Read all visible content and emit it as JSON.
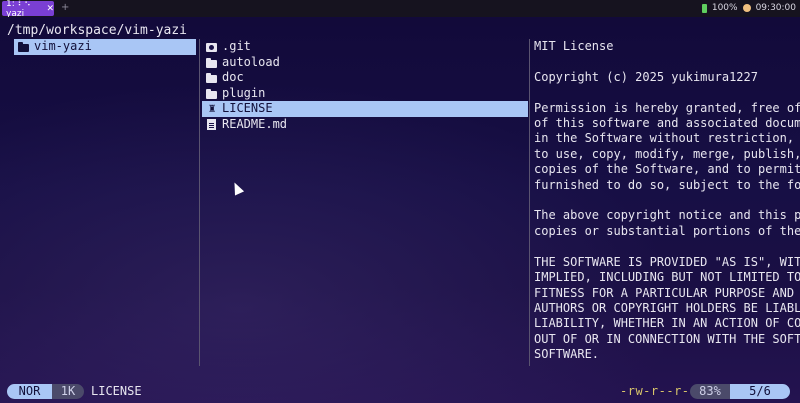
{
  "window": {
    "tab_label": "1: ⠇⠢ yazi",
    "tab_close": "✕",
    "new_tab": "+",
    "battery": "100%",
    "time": "09:30:00"
  },
  "yazi": {
    "cwd": "/tmp/workspace/vim-yazi",
    "parent_items": [
      {
        "name": "vim-yazi",
        "icon": "folder-icon",
        "selected": true
      }
    ],
    "current_items": [
      {
        "name": ".git",
        "icon": "git-folder-icon",
        "selected": false
      },
      {
        "name": "autoload",
        "icon": "folder-icon",
        "selected": false
      },
      {
        "name": "doc",
        "icon": "folder-icon",
        "selected": false
      },
      {
        "name": "plugin",
        "icon": "folder-icon",
        "selected": false
      },
      {
        "name": "LICENSE",
        "icon": "license-icon",
        "selected": true
      },
      {
        "name": "README.md",
        "icon": "markdown-file-icon",
        "selected": false
      }
    ],
    "preview_text": "MIT License\n\nCopyright (c) 2025 yukimura1227\n\nPermission is hereby granted, free of\nof this software and associated docume\nin the Software without restriction, i\nto use, copy, modify, merge, publish,\ncopies of the Software, and to permit\nfurnished to do so, subject to the fol\n\nThe above copyright notice and this pe\ncopies or substantial portions of the\n\nTHE SOFTWARE IS PROVIDED \"AS IS\", WITH\nIMPLIED, INCLUDING BUT NOT LIMITED TO\nFITNESS FOR A PARTICULAR PURPOSE AND N\nAUTHORS OR COPYRIGHT HOLDERS BE LIABLE\nLIABILITY, WHETHER IN AN ACTION OF CON\nOUT OF OR IN CONNECTION WITH THE SOFTW\nSOFTWARE.",
    "status": {
      "mode": "NOR",
      "size": "1K",
      "filename": "LICENSE",
      "permissions": "-rw-r--r--",
      "percent": "83%",
      "position": "5/6"
    }
  },
  "colors": {
    "selection": "#a9c6f5",
    "accent_tab": "#7a3fd4",
    "permissions": "#d9c56a"
  }
}
